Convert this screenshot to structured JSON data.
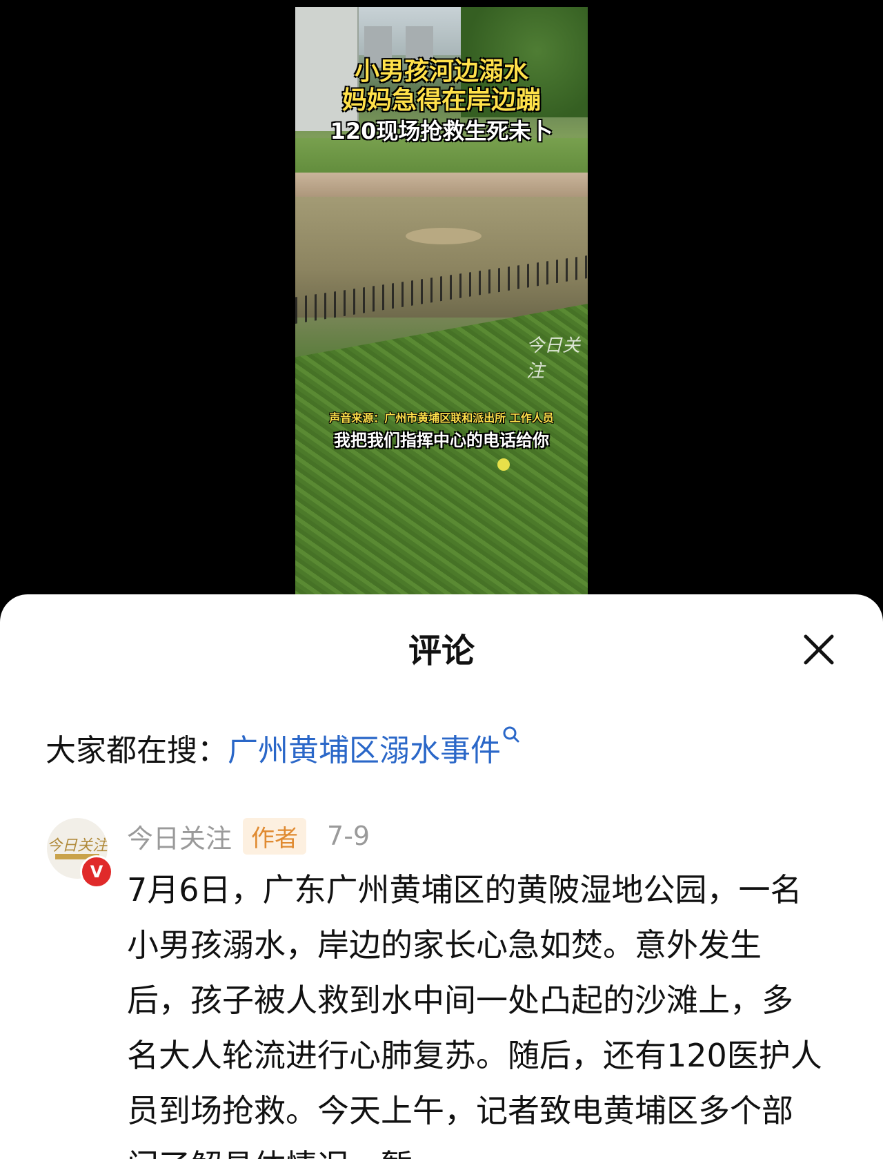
{
  "video": {
    "title_line1": "小男孩河边溺水",
    "title_line2": "妈妈急得在岸边蹦",
    "title_line3": "120现场抢救生死未卜",
    "audio_source": "声音来源：广州市黄埔区联和派出所 工作人员",
    "speech_subtitle": "我把我们指挥中心的电话给你",
    "watermark": "今日关注"
  },
  "sheet": {
    "title": "评论",
    "close_icon": "close-icon"
  },
  "search": {
    "label": "大家都在搜：",
    "query": "广州黄埔区溺水事件",
    "icon": "search-icon"
  },
  "comment": {
    "avatar_text": "今日关注",
    "verified_badge": "V",
    "author": "今日关注",
    "author_tag": "作者",
    "date": "7-9",
    "body": "7月6日，广东广州黄埔区的黄陂湿地公园，一名小男孩溺水，岸边的家长心急如焚。意外发生后，孩子被人救到水中间一处凸起的沙滩上，多名大人轮流进行心肺复苏。随后，还有120医护人员到场抢救。今天上午，记者致电黄埔区多个部门了解具体情况，暂"
  },
  "colors": {
    "link": "#2a67c8",
    "author_tag_bg": "#fdf0e0",
    "author_tag_text": "#e08a30",
    "verified": "#e02a2a",
    "caption_yellow": "#ffe14a"
  }
}
